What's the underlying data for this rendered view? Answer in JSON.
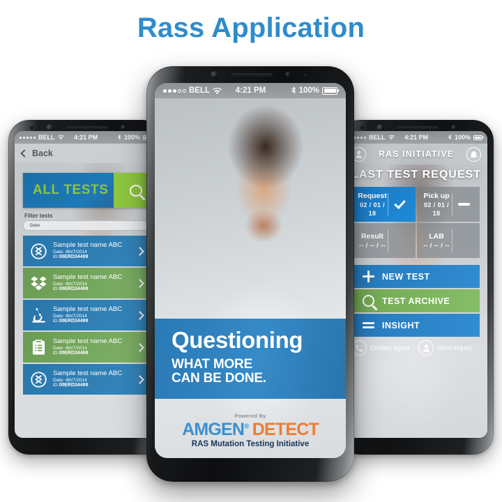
{
  "page": {
    "title": "Rass Application",
    "title_color": "#2e8ccb",
    "background": "#ffffff"
  },
  "theme": {
    "blue": "#1b79c4",
    "green": "#8dc63f",
    "green_row": "#6aa548",
    "orange": "#ee7b33",
    "navy": "#16365c"
  },
  "status_bar": {
    "carrier": "BELL",
    "time": "4:21 PM",
    "battery": "100%"
  },
  "left_phone": {
    "nav": {
      "back_label": "Back"
    },
    "banner": {
      "label": "ALL TESTS",
      "search_icon": "search-icon"
    },
    "filter": {
      "label": "Filter tests",
      "date_value": "Date"
    },
    "tests": [
      {
        "icon": "dna-circle-icon",
        "name": "Sample test name ABC",
        "date": "Date: 4th/7/2014",
        "id_prefix": "ID ",
        "id": "00ERD34499",
        "color": "blue"
      },
      {
        "icon": "box-diamond-icon",
        "name": "Sample test name ABC",
        "date": "Date: 4th/7/2014",
        "id_prefix": "ID ",
        "id": "00ERD34499",
        "color": "green"
      },
      {
        "icon": "microscope-icon",
        "name": "Sample test name ABC",
        "date": "Date: 4th/7/2014",
        "id_prefix": "ID ",
        "id": "00ERD34499",
        "color": "blue"
      },
      {
        "icon": "clipboard-icon",
        "name": "Sample test name ABC",
        "date": "Date: 4th/7/2014",
        "id_prefix": "ID ",
        "id": "00ERD34499",
        "color": "green"
      },
      {
        "icon": "dna-circle-icon",
        "name": "Sample test name ABC",
        "date": "Date: 4th/7/2014",
        "id_prefix": "ID ",
        "id": "00ERD34499",
        "color": "blue"
      }
    ]
  },
  "center_phone": {
    "headline": "Questioning",
    "sub1": "WHAT MORE",
    "sub2": "CAN BE DONE.",
    "powered_by": "Powered By",
    "brand_amgen": "AMGEN",
    "brand_reg": "®",
    "brand_detect": "DETECT",
    "tagline": "RAS Mutation Testing Initiative"
  },
  "right_phone": {
    "header": {
      "title": "RAS INITIATIVE",
      "left_icon": "user-icon",
      "right_icon": "bell-icon"
    },
    "section_title": "LAST TEST REQUEST",
    "cards": [
      {
        "label": "Request",
        "date": "02 / 01 / 18",
        "mark": "check",
        "active": true
      },
      {
        "label": "Pick up",
        "date": "02 / 01 / 18",
        "mark": "dash",
        "active": false
      },
      {
        "label": "Result",
        "date": "-- / -- / --",
        "mark": "",
        "active": false
      },
      {
        "label": "LAB",
        "date": "-- / -- / --",
        "mark": "",
        "active": false
      }
    ],
    "actions": [
      {
        "label": "NEW TEST",
        "icon": "plus-icon",
        "color": "blue"
      },
      {
        "label": "TEST ARCHIVE",
        "icon": "search-icon",
        "color": "green"
      },
      {
        "label": "INSIGHT",
        "icon": "menu-lines-icon",
        "color": "blue"
      }
    ],
    "footer": [
      {
        "label": "Contact agent",
        "icon": "phone-icon"
      },
      {
        "label": "Send inquiry",
        "icon": "user-icon"
      }
    ]
  }
}
